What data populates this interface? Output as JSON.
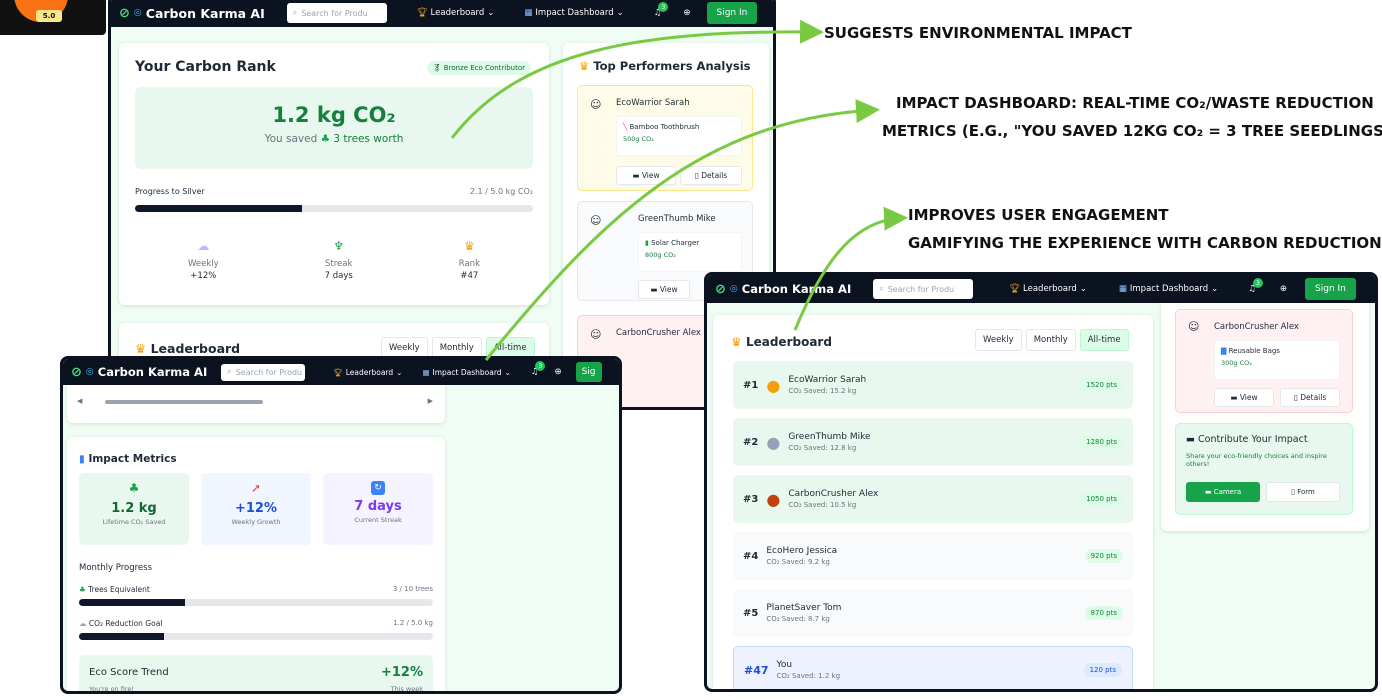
{
  "logo": {
    "rating": "5.0"
  },
  "app": {
    "title": "Carbon Karma AI",
    "search_placeholder": "Search for Produ",
    "nav_leaderboard": "Leaderboard",
    "nav_impact": "Impact Dashboard",
    "notif_count": "3",
    "signin": "Sign In",
    "signin_short": "Sig"
  },
  "rank_card": {
    "title": "Your Carbon Rank",
    "badge": "Bronze Eco Contributor",
    "co2": "1.2 kg CO₂",
    "saved_prefix": "You saved",
    "trees": "3 trees worth",
    "progress_label": "Progress to Silver",
    "progress_value": "2.1 / 5.0 kg CO₂",
    "progress_fraction": 0.42,
    "stats": [
      {
        "label": "Weekly",
        "value": "+12%"
      },
      {
        "label": "Streak",
        "value": "7 days"
      },
      {
        "label": "Rank",
        "value": "#47"
      }
    ]
  },
  "leaderboard": {
    "title": "Leaderboard",
    "tabs": [
      "Weekly",
      "Monthly",
      "All-time"
    ],
    "tab_short": "All-time",
    "rows": [
      {
        "rank": "#1",
        "name": "EcoWarrior Sarah",
        "saved": "CO₂ Saved: 15.2 kg",
        "pts": "1520 pts"
      },
      {
        "rank": "#2",
        "name": "GreenThumb Mike",
        "saved": "CO₂ Saved: 12.8 kg",
        "pts": "1280 pts"
      },
      {
        "rank": "#3",
        "name": "CarbonCrusher Alex",
        "saved": "CO₂ Saved: 10.5 kg",
        "pts": "1050 pts"
      },
      {
        "rank": "#4",
        "name": "EcoHero Jessica",
        "saved": "CO₂ Saved: 9.2 kg",
        "pts": "920 pts"
      },
      {
        "rank": "#5",
        "name": "PlanetSaver Tom",
        "saved": "CO₂ Saved: 8.7 kg",
        "pts": "870 pts"
      },
      {
        "rank": "#47",
        "name": "You",
        "saved": "CO₂ Saved: 1.2 kg",
        "pts": "120 pts"
      }
    ]
  },
  "performers": {
    "title": "Top Performers Analysis",
    "items": [
      {
        "name": "EcoWarrior Sarah",
        "product": "Bamboo Toothbrush",
        "co2": "500g CO₂"
      },
      {
        "name": "GreenThumb Mike",
        "product": "Solar Charger",
        "co2": "800g CO₂"
      },
      {
        "name": "CarbonCrusher Alex",
        "product": "Reusable Bags",
        "co2": "300g CO₂"
      }
    ],
    "view": "View",
    "details": "Details"
  },
  "metrics": {
    "title": "Impact Metrics",
    "tiles": [
      {
        "value": "1.2 kg",
        "label": "Lifetime CO₂ Saved"
      },
      {
        "value": "+12%",
        "label": "Weekly Growth"
      },
      {
        "value": "7 days",
        "label": "Current Streak"
      }
    ],
    "monthly_title": "Monthly Progress",
    "trees_label": "Trees Equivalent",
    "trees_value": "3 / 10 trees",
    "trees_fraction": 0.3,
    "goal_label": "CO₂ Reduction Goal",
    "goal_value": "1.2 / 5.0 kg",
    "goal_fraction": 0.24,
    "trend_title": "Eco Score Trend",
    "trend_value": "+12%",
    "trend_sub": "You're on fire!",
    "trend_week": "This week"
  },
  "contribute": {
    "title": "Contribute Your Impact",
    "text": "Share your eco-friendly choices and inspire others!",
    "camera": "Camera",
    "form": "Form"
  },
  "annotations": {
    "a1": "SUGGESTS ENVIRONMENTAL IMPACT",
    "a2_line1": "IMPACT DASHBOARD: REAL-TIME CO₂/WASTE REDUCTION",
    "a2_line2": "METRICS (E.G., \"YOU SAVED 12KG CO₂ = 3 TREE SEEDLINGS\").",
    "a3_line1": "IMPROVES USER  ENGAGEMENT",
    "a3_line2": "GAMIFYING THE EXPERIENCE WITH CARBON REDUCTION"
  },
  "colors": {
    "accent": "#16a34a",
    "navbar": "#0b1220",
    "arrow": "#7ac943"
  }
}
